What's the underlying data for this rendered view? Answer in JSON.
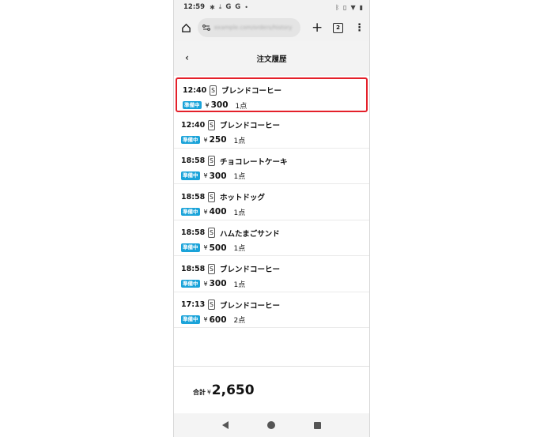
{
  "status_bar": {
    "time": "12:59",
    "left_icons": [
      "gear-icon",
      "download-icon",
      "google-icon",
      "google-icon",
      "dot-icon"
    ],
    "right_icons": [
      "bluetooth-icon",
      "vibrate-icon",
      "wifi-icon",
      "battery-icon"
    ]
  },
  "browser": {
    "url": "example.com/orders/history",
    "tab_count": "2"
  },
  "header": {
    "title": "注文履歴"
  },
  "orders": [
    {
      "time": "12:40",
      "size": "S",
      "name": "ブレンドコーヒー",
      "status": "準備中",
      "price": "300",
      "qty": "1点",
      "highlighted": true
    },
    {
      "time": "12:40",
      "size": "S",
      "name": "ブレンドコーヒー",
      "status": "準備中",
      "price": "250",
      "qty": "1点",
      "highlighted": false
    },
    {
      "time": "18:58",
      "size": "S",
      "name": "チョコレートケーキ",
      "status": "準備中",
      "price": "300",
      "qty": "1点",
      "highlighted": false
    },
    {
      "time": "18:58",
      "size": "S",
      "name": "ホットドッグ",
      "status": "準備中",
      "price": "400",
      "qty": "1点",
      "highlighted": false
    },
    {
      "time": "18:58",
      "size": "S",
      "name": "ハムたまごサンド",
      "status": "準備中",
      "price": "500",
      "qty": "1点",
      "highlighted": false
    },
    {
      "time": "18:58",
      "size": "S",
      "name": "ブレンドコーヒー",
      "status": "準備中",
      "price": "300",
      "qty": "1点",
      "highlighted": false
    },
    {
      "time": "17:13",
      "size": "S",
      "name": "ブレンドコーヒー",
      "status": "準備中",
      "price": "600",
      "qty": "2点",
      "highlighted": false
    }
  ],
  "currency": "¥",
  "total": {
    "label": "合計",
    "value": "2,650"
  },
  "colors": {
    "status_badge": "#1aa3d9",
    "highlight_border": "#e4202a"
  }
}
